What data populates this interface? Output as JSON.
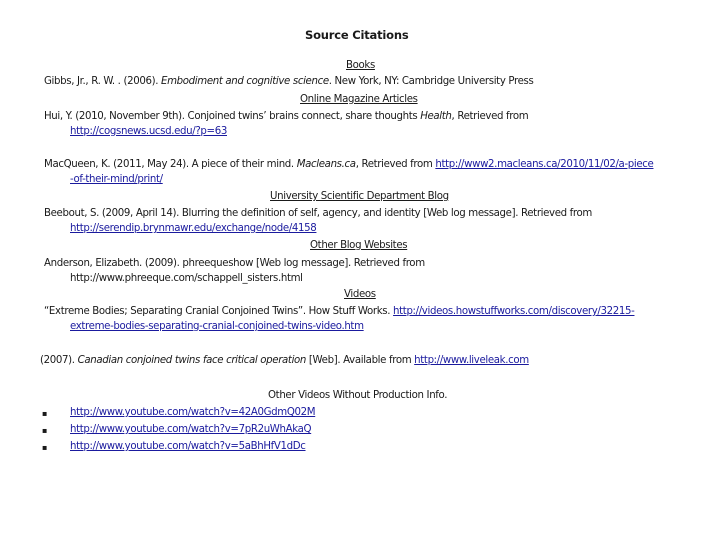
{
  "title": "Source Citations",
  "sections": {
    "books": {
      "heading": "Books",
      "citation": {
        "before": "Gibbs, Jr., R. W. . (2006). ",
        "title_italic": "Embodiment and cognitive science",
        "after": ". New York, NY: Cambridge University Press"
      }
    },
    "magazines": {
      "heading": "Online Magazine Articles",
      "citations": [
        {
          "before": "Hui, Y. (2010, November 9th). Conjoined twins’ brains connect, share thoughts ",
          "title_italic": "Health",
          "after": ", Retrieved from",
          "link": "http://cogsnews.ucsd.edu/?p=63"
        },
        {
          "before": "MacQueen, K. (2011, May 24). A piece of their mind. ",
          "title_italic": "Macleans.ca",
          "after": ", Retrieved from ",
          "link_line1": "http://www2.macleans.ca/2010/11/02/a-piece",
          "link_line2": "-of-their-mind/print/"
        }
      ]
    },
    "university_blog": {
      "heading": "University Scientific Department Blog",
      "citation": {
        "text": "Beebout, S. (2009, April 14). Blurring the definition of self, agency, and identity [Web log message]. Retrieved from",
        "link": "http://serendip.brynmawr.edu/exchange/node/4158"
      }
    },
    "other_blogs": {
      "heading": "Other Blog Websites",
      "citation": {
        "text": "Anderson, Elizabeth. (2009). phreequeshow [Web log message]. Retrieved from",
        "url_plain": "http://www.phreeque.com/schappell_sisters.html"
      }
    },
    "videos": {
      "heading": "Videos",
      "citations": [
        {
          "text": "“Extreme Bodies; Separating Cranial Conjoined Twins”. How Stuff Works. ",
          "link_line1": "http://videos.howstuffworks.com/discovery/32215-",
          "link_line2": "extreme-bodies-separating-cranial-conjoined-twins-video.htm"
        },
        {
          "before": "(2007). ",
          "title_italic": "Canadian conjoined twins face critical operation",
          "after": " [Web]. Available from ",
          "link": "http://www.liveleak.com"
        }
      ]
    },
    "other_videos": {
      "heading": "Other Videos Without Production Info.",
      "bullet": "▪",
      "links": [
        "http://www.youtube.com/watch?v=42A0GdmQ02M",
        "http://www.youtube.com/watch?v=7pR2uWhAkaQ",
        "http://www.youtube.com/watch?v=5aBhHfV1dDc"
      ]
    }
  },
  "colors": {
    "link": "#1a1a9e",
    "text": "#1a1a1a"
  }
}
